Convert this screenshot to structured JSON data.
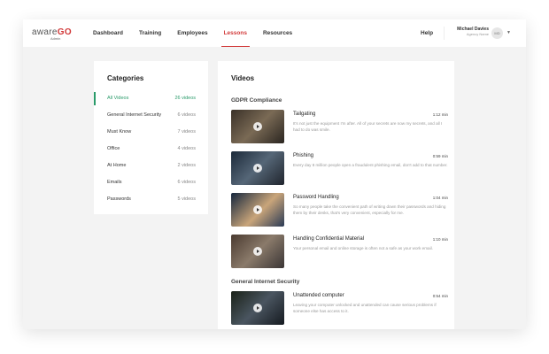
{
  "header": {
    "logo": "aware",
    "logo_accent": "GO",
    "logo_sub": "Admin",
    "nav": [
      {
        "label": "Dashboard"
      },
      {
        "label": "Training"
      },
      {
        "label": "Employees"
      },
      {
        "label": "Lessons",
        "active": true
      },
      {
        "label": "Resources"
      }
    ],
    "help": "Help",
    "user": {
      "name": "Michael Davies",
      "org": "Agency Name",
      "initials": "MD"
    }
  },
  "categories": {
    "title": "Categories",
    "items": [
      {
        "name": "All Videos",
        "count": "26 videos",
        "active": true
      },
      {
        "name": "General Internet Security",
        "count": "6 videos"
      },
      {
        "name": "Must Know",
        "count": "7 videos"
      },
      {
        "name": "Office",
        "count": "4 videos"
      },
      {
        "name": "At Home",
        "count": "2 videos"
      },
      {
        "name": "Emails",
        "count": "6 videos"
      },
      {
        "name": "Passwords",
        "count": "5 videos"
      }
    ]
  },
  "videos": {
    "title": "Videos",
    "sections": [
      {
        "title": "GDPR Compliance",
        "items": [
          {
            "title": "Tailgating",
            "duration": "1:12 min",
            "desc": "It's not just the equipment I'm after. All of your secrets are now my secrets, and all I had to do was smile."
          },
          {
            "title": "Phishing",
            "duration": "0:59 min",
            "desc": "Every day 8 million people open a fraudulent phishing email, don't add to that number."
          },
          {
            "title": "Password Handling",
            "duration": "1:04 min",
            "desc": "So many people take the convenient path of writing down their passwords and hiding them by their desks, that's very convenient, especially for me."
          },
          {
            "title": "Handling Confidential Material",
            "duration": "1:10 min",
            "desc": "Your personal email and online storage is often not a safe as your work email."
          }
        ]
      },
      {
        "title": "General Internet Security",
        "items": [
          {
            "title": "Unattended computer",
            "duration": "0:54 min",
            "desc": "Leaving your computer unlocked and unattended can cause serious problems if someone else has access to it."
          }
        ]
      }
    ]
  }
}
